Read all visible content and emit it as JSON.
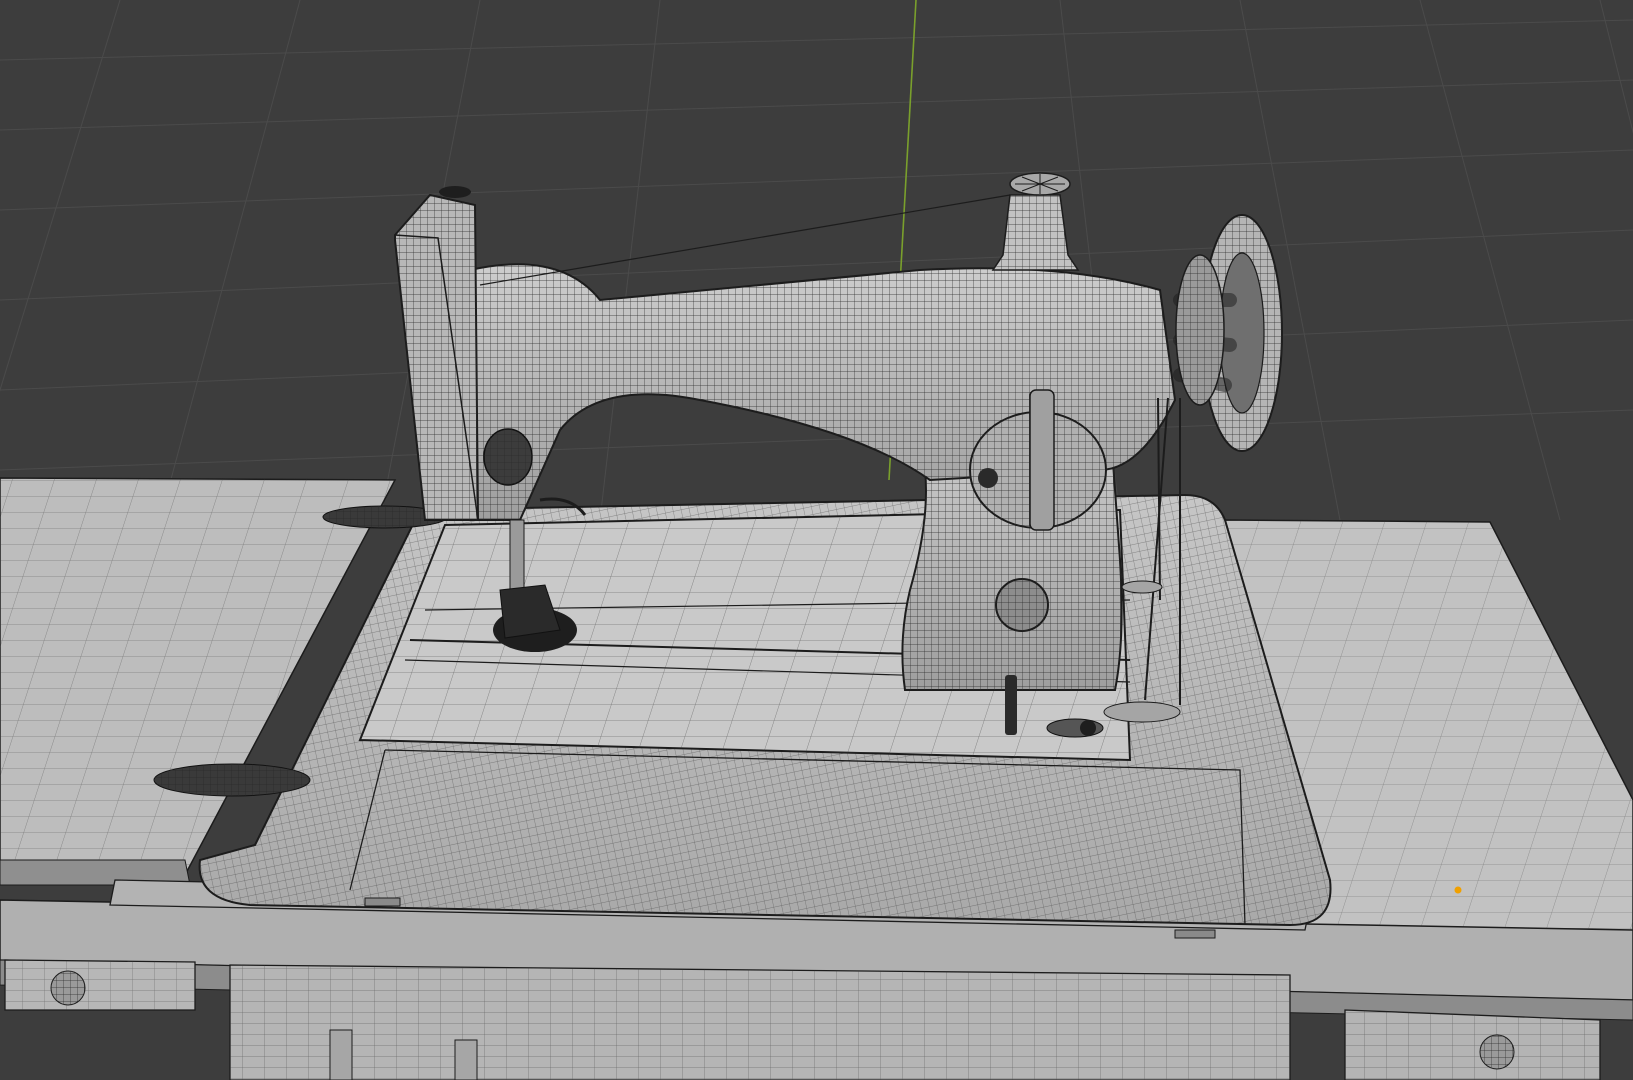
{
  "app": {
    "name": "3D viewport",
    "mode": "wireframe-overlay"
  },
  "scene": {
    "object": "sewing-machine-on-treadle-table",
    "icons": {
      "object_origin": "origin-dot-icon",
      "y_axis": "axis-line-icon"
    }
  },
  "colors": {
    "background": "#3d3d3d",
    "grid_line": "#4b4b4b",
    "y_axis": "#7aa02c",
    "mesh_fill": "#b9b9b9",
    "mesh_fill_light": "#cfcfcf",
    "mesh_shade": "#8e8e8e",
    "wire": "#1c1c1c",
    "origin_dot": "#f0a000"
  }
}
